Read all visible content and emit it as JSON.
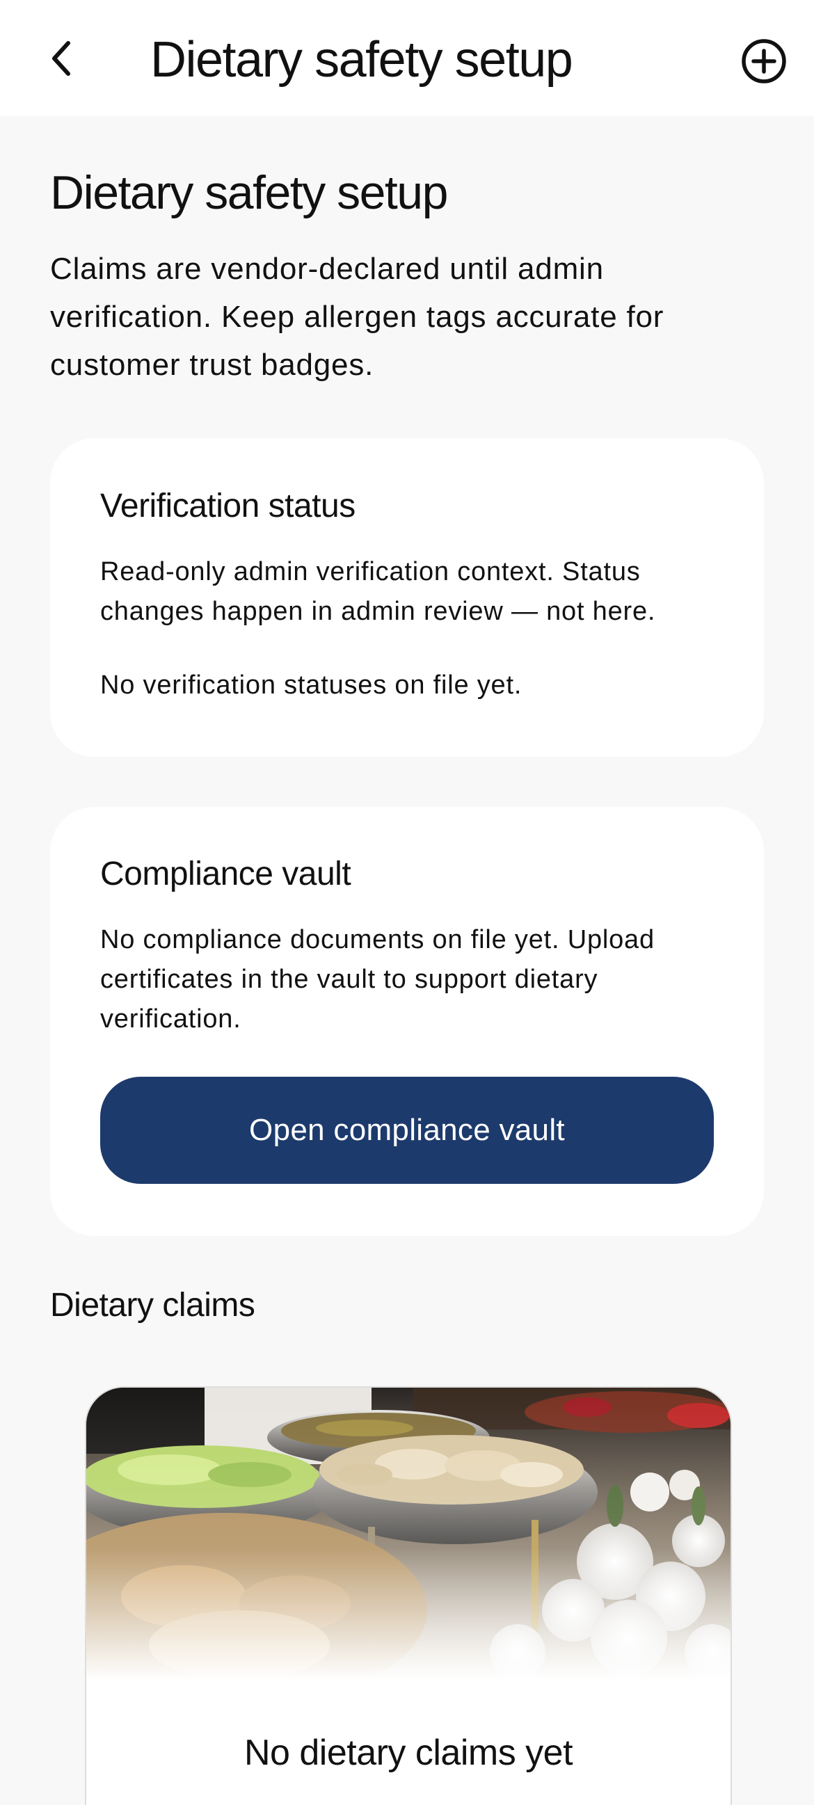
{
  "header": {
    "back_icon": "chevron-left-icon",
    "title": "Dietary safety setup",
    "add_icon": "plus-circle-icon"
  },
  "page": {
    "title": "Dietary safety setup",
    "intro": "Claims are vendor-declared until admin verification. Keep allergen tags accurate for customer trust badges."
  },
  "verification": {
    "title": "Verification status",
    "description": "Read-only admin verification context. Status changes happen in admin review — not here.",
    "empty_text": "No verification statuses on file yet."
  },
  "vault": {
    "title": "Compliance vault",
    "description": "No compliance documents on file yet. Upload certificates in the vault to support dietary verification.",
    "button_label": "Open compliance vault",
    "button_color": "#1d3a6c"
  },
  "dietary_claims": {
    "heading": "Dietary claims",
    "empty_title": "No dietary claims yet"
  }
}
